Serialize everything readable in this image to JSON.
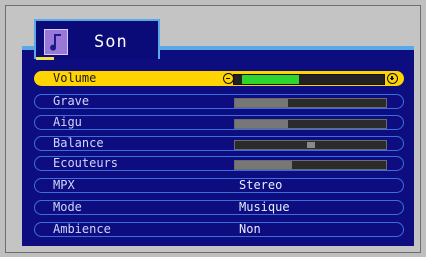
{
  "menu": {
    "title": "Son",
    "icon": "music-note-icon"
  },
  "items": [
    {
      "label": "Volume",
      "type": "slider",
      "level": 0.4,
      "selected": true
    },
    {
      "label": "Grave",
      "type": "slider",
      "level": 0.35
    },
    {
      "label": "Aigu",
      "type": "slider",
      "level": 0.35
    },
    {
      "label": "Balance",
      "type": "slider",
      "level": 0.5,
      "knob": true
    },
    {
      "label": "Ecouteurs",
      "type": "slider",
      "level": 0.38
    },
    {
      "label": "MPX",
      "type": "value",
      "value": "Stereo"
    },
    {
      "label": "Mode",
      "type": "value",
      "value": "Musique"
    },
    {
      "label": "Ambience",
      "type": "value",
      "value": "Non"
    }
  ],
  "colors": {
    "panel": "#0d0d80",
    "accent": "#59a9e6",
    "selected": "#ffd400",
    "volume_fill": "#2ed52e"
  }
}
